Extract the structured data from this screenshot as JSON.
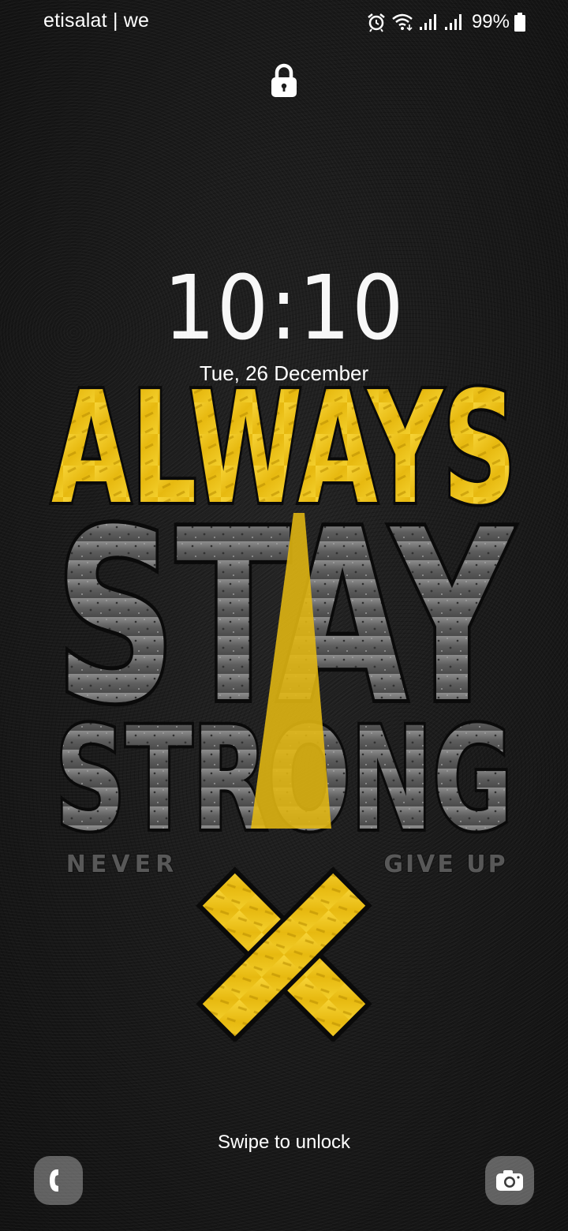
{
  "status_bar": {
    "carrier": "etisalat | we",
    "battery": "99%",
    "icons": [
      "alarm-icon",
      "wifi-icon",
      "signal-icon",
      "signal-icon",
      "battery-icon"
    ]
  },
  "lock": {
    "icon": "lock-icon"
  },
  "clock": {
    "time": "10:10",
    "date": "Tue, 26 December"
  },
  "wallpaper": {
    "line1": "ALWAYS",
    "line2": "STAY",
    "line3": "STRONG",
    "left_caption": "NEVER",
    "right_caption": "GIVE UP",
    "accent_color": "#f2c316",
    "road_color": "#6a6a6a"
  },
  "footer": {
    "swipe_text": "Swipe to unlock",
    "left_shortcut_icon": "phone-icon",
    "right_shortcut_icon": "camera-icon"
  }
}
